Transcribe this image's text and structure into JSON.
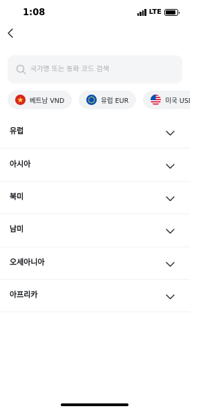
{
  "status_bar": {
    "time": "1:08",
    "network": "LTE",
    "battery_level": 0.85
  },
  "search": {
    "placeholder": "국가명 또는 통화 코드 검색",
    "value": ""
  },
  "chips": [
    {
      "label": "베트남 VND",
      "flag": "vietnam-flag-icon"
    },
    {
      "label": "유럽 EUR",
      "flag": "eu-flag-icon"
    },
    {
      "label": "미국 USD",
      "flag": "us-flag-icon"
    }
  ],
  "regions": [
    {
      "label": "유럽"
    },
    {
      "label": "아시아"
    },
    {
      "label": "북미"
    },
    {
      "label": "남미"
    },
    {
      "label": "오세아니아"
    },
    {
      "label": "아프리카"
    }
  ],
  "colors": {
    "background": "#ffffff",
    "field": "#f4f5f7",
    "chip": "#f2f3f5",
    "divider": "#f0f1f3",
    "vietnam_red": "#da251d",
    "eu_blue": "#0052b4",
    "us_red": "#d80027"
  }
}
